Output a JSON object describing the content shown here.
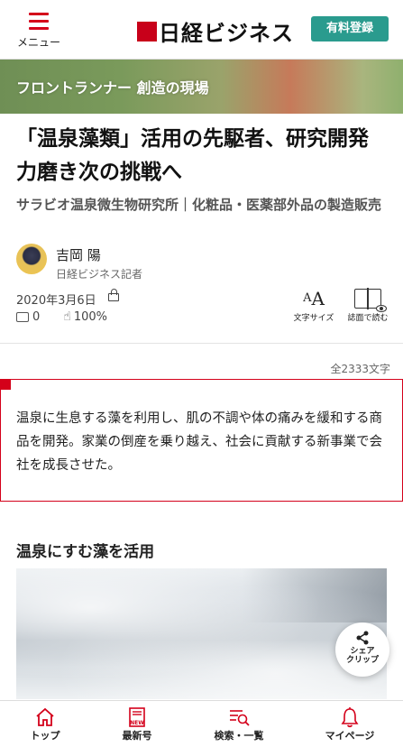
{
  "header": {
    "menu_label": "メニュー",
    "logo_text": "日経ビジネス",
    "signup_label": "有料登録"
  },
  "banner": {
    "text": "フロントランナー 創造の現場"
  },
  "article": {
    "title": "「温泉藻類」活用の先駆者、研究開発力磨き次の挑戦へ",
    "subtitle": "サラビオ温泉微生物研究所｜化粧品・医薬部外品の製造販売",
    "author_name": "吉岡 陽",
    "author_role": "日経ビジネス記者",
    "date": "2020年3月6日",
    "comments": "0",
    "likes": "100%",
    "font_size_label": "文字サイズ",
    "read_in_paper_label": "誌面で読む",
    "word_count": "全2333文字",
    "lead": "温泉に生息する藻を利用し、肌の不調や体の痛みを緩和する商品を開発。家業の倒産を乗り越え、社会に貢献する新事業で会社を成長させた。",
    "section_title": "温泉にすむ藻を活用"
  },
  "share": {
    "line1": "シェア",
    "line2": "クリップ"
  },
  "tabbar": {
    "items": [
      {
        "label": "トップ",
        "icon": "home-icon"
      },
      {
        "label": "最新号",
        "icon": "new-issue-icon",
        "badge": "NEW"
      },
      {
        "label": "検索・一覧",
        "icon": "search-list-icon"
      },
      {
        "label": "マイページ",
        "icon": "bell-icon"
      }
    ]
  },
  "colors": {
    "brand_red": "#d4001a",
    "signup_green": "#2a9b8e"
  }
}
